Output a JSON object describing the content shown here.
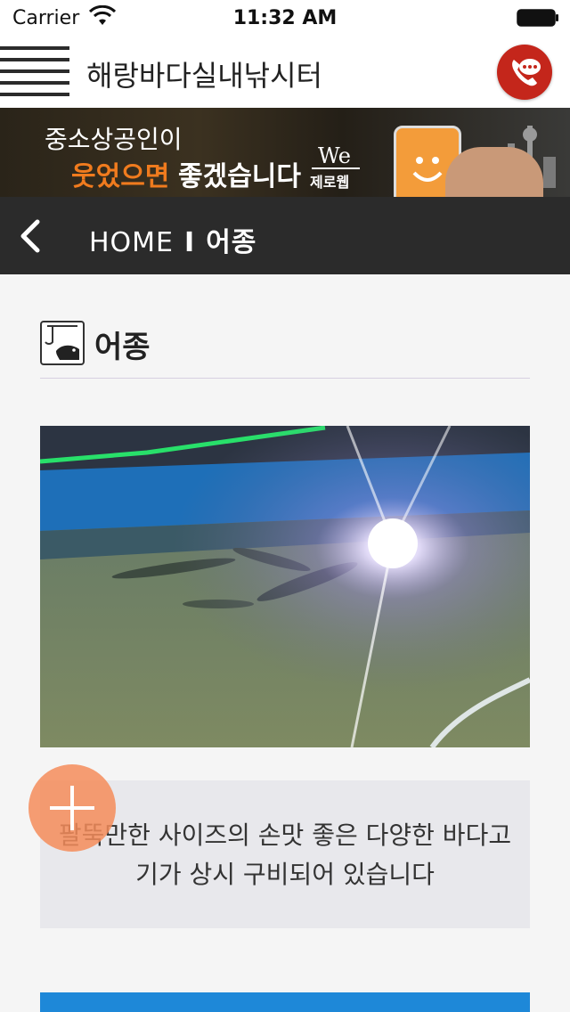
{
  "status_bar": {
    "carrier": "Carrier",
    "time": "11:32 AM",
    "icons": [
      "wifi-icon",
      "battery-icon"
    ]
  },
  "header": {
    "title": "해랑바다실내낚시터",
    "menu_icon": "hamburger-menu-icon",
    "call_icon": "phone-chat-icon",
    "accent_color": "#c4261b"
  },
  "ad_banner": {
    "line1": "중소상공인이",
    "line2_highlight": "웃었으면",
    "line2_rest": "좋겠습니다",
    "logo_top": "We",
    "logo_bottom": "제로웹"
  },
  "nav": {
    "home": "HOME",
    "separator": "I",
    "current": "어종",
    "back_icon": "chevron-left-icon"
  },
  "section": {
    "icon": "fishing-hook-icon",
    "title": "어종"
  },
  "description": "팔뚝만한 사이즈의 손맛 좋은 다양한 바다고기가 상시 구비되어 있습니다",
  "fab_icon": "plus-icon",
  "colors": {
    "nav_bg": "#2b2b2b",
    "fab": "#f58c5a",
    "bottom_strip": "#1e88d8"
  }
}
